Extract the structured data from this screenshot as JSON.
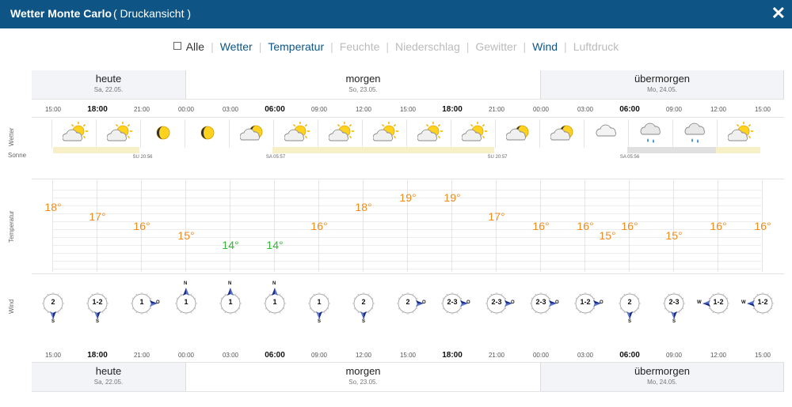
{
  "header": {
    "title": "Wetter Monte Carlo",
    "subtitle": "( Druckansicht )",
    "close_label": "✕"
  },
  "filters": [
    {
      "label": "Alle",
      "state": "all"
    },
    {
      "label": "Wetter",
      "state": "on"
    },
    {
      "label": "Temperatur",
      "state": "on"
    },
    {
      "label": "Feuchte",
      "state": "off"
    },
    {
      "label": "Niederschlag",
      "state": "off"
    },
    {
      "label": "Gewitter",
      "state": "off"
    },
    {
      "label": "Wind",
      "state": "on"
    },
    {
      "label": "Luftdruck",
      "state": "off"
    }
  ],
  "days": [
    {
      "name": "heute",
      "date": "Sa, 22.05.",
      "shaded": true
    },
    {
      "name": "morgen",
      "date": "So, 23.05.",
      "shaded": false
    },
    {
      "name": "übermorgen",
      "date": "Mo, 24.05.",
      "shaded": true
    }
  ],
  "row_labels": {
    "weather": "Wetter",
    "sun": "Sonne",
    "temperature": "Temperatur",
    "wind": "Wind"
  },
  "times": [
    "15:00",
    "18:00",
    "21:00",
    "00:00",
    "03:00",
    "06:00",
    "09:00",
    "12:00",
    "15:00",
    "18:00",
    "21:00",
    "00:00",
    "03:00",
    "06:00",
    "09:00",
    "12:00",
    "15:00"
  ],
  "major_times": [
    "18:00",
    "06:00"
  ],
  "weather_icons": [
    "partly-sunny-icon",
    "partly-sunny-icon",
    "moon-icon",
    "moon-icon",
    "partly-cloudy-night-icon",
    "partly-sunny-icon",
    "partly-sunny-icon",
    "partly-sunny-icon",
    "partly-sunny-icon",
    "partly-sunny-icon",
    "partly-cloudy-night-icon",
    "partly-cloudy-night-icon",
    "cloudy-icon",
    "rain-icon",
    "rain-icon",
    "partly-sunny-icon"
  ],
  "sun_times": [
    {
      "label": "SU 20:56"
    },
    {
      "label": "SA 05:57"
    },
    {
      "label": "SU 20:57"
    },
    {
      "label": "SA 05:56"
    }
  ],
  "temperatures": [
    "18°",
    "17°",
    "16°",
    "15°",
    "14°",
    "14°",
    "16°",
    "18°",
    "19°",
    "19°",
    "17°",
    "16°",
    "16°",
    "15°",
    "16°",
    "15°",
    "16°",
    "16°"
  ],
  "temperature_colors": {
    "warm": "#f08c1e",
    "cool": "#33b533"
  },
  "wind": [
    {
      "speed": "2",
      "dir": "S"
    },
    {
      "speed": "1-2",
      "dir": "S"
    },
    {
      "speed": "1",
      "dir": "O"
    },
    {
      "speed": "1",
      "dir": "N"
    },
    {
      "speed": "1",
      "dir": "N"
    },
    {
      "speed": "1",
      "dir": "N"
    },
    {
      "speed": "1",
      "dir": "S"
    },
    {
      "speed": "2",
      "dir": "S"
    },
    {
      "speed": "2",
      "dir": "O"
    },
    {
      "speed": "2-3",
      "dir": "O"
    },
    {
      "speed": "2-3",
      "dir": "O"
    },
    {
      "speed": "2-3",
      "dir": "O"
    },
    {
      "speed": "1-2",
      "dir": "O"
    },
    {
      "speed": "2",
      "dir": "S"
    },
    {
      "speed": "2-3",
      "dir": "S"
    },
    {
      "speed": "1-2",
      "dir": "W"
    },
    {
      "speed": "1-2",
      "dir": "W"
    }
  ],
  "colors": {
    "header_bg": "#0e5585",
    "filter_on": "#0e5585",
    "filter_off": "#bbbbbb",
    "sun_day": "#f7efc5",
    "sun_cloud": "#e0e0e0"
  }
}
